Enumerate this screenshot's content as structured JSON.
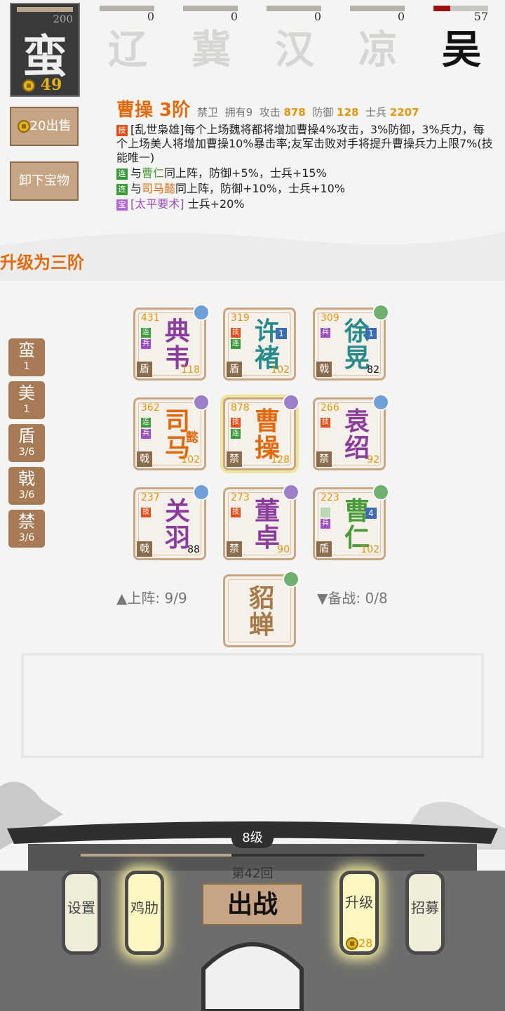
{
  "factions": [
    {
      "glyph": "蛮",
      "count": "200",
      "gold": "49",
      "active": true
    },
    {
      "glyph": "辽",
      "count": "0"
    },
    {
      "glyph": "冀",
      "count": "0"
    },
    {
      "glyph": "汉",
      "count": "0"
    },
    {
      "glyph": "凉",
      "count": "0"
    },
    {
      "glyph": "吴",
      "count": "57",
      "progress": 0.3,
      "highlight": true
    }
  ],
  "left_buttons": {
    "sell": "20出售",
    "unequip": "卸下宝物"
  },
  "hero": {
    "name": "曹操 3阶",
    "stats": [
      {
        "k": "禁卫",
        "v": ""
      },
      {
        "k": "拥有9",
        "v": ""
      },
      {
        "k": "攻击",
        "v": "878"
      },
      {
        "k": "防御",
        "v": "128"
      },
      {
        "k": "士兵",
        "v": "2207"
      }
    ],
    "skill_tag": "技",
    "skill": "[乱世枭雄]每个上场魏将都将增加曹操4%攻击，3%防御，3%兵力，每个上场美人将增加曹操10%暴击率;友军击败对手将提升曹操兵力上限7%(技能唯一)",
    "link_tag": "连",
    "link1_pre": "与",
    "link1_name": "曹仁",
    "link1_post": "同上阵，防御+5%，士兵+15%",
    "link2_pre": "与",
    "link2_name": "司马懿",
    "link2_post": "同上阵，防御+10%，士兵+10%",
    "treasure_tag": "宝",
    "treasure_name": "[太平要术]",
    "treasure_post": " 士兵+20%"
  },
  "upgrade_text": "升级为三阶",
  "filters": [
    {
      "t": "蛮",
      "n": "1"
    },
    {
      "t": "美",
      "n": "1"
    },
    {
      "t": "盾",
      "n": "3/6"
    },
    {
      "t": "戟",
      "n": "3/6"
    },
    {
      "t": "禁",
      "n": "3/6"
    }
  ],
  "cards": [
    {
      "lvl": "431",
      "name1": "典",
      "name2": "韦",
      "cls": "盾",
      "pw": "118",
      "color": "#8a3d9a",
      "tags": [
        "连",
        "兵"
      ],
      "eq": "#6f9fd9"
    },
    {
      "lvl": "319",
      "name1": "许",
      "name2": "褚",
      "cls": "盾",
      "pw": "102",
      "color": "#2a8a8a",
      "tags": [
        "技",
        "连"
      ],
      "eq": "",
      "star": "1"
    },
    {
      "lvl": "309",
      "name1": "徐",
      "name2": "晃",
      "cls": "戟",
      "pw": "82",
      "color": "#2a8a8a",
      "tags": [
        "兵"
      ],
      "eq": "#6fb06f",
      "star": "1",
      "pwk": true
    },
    {
      "lvl": "362",
      "name1": "司",
      "name2": "马",
      "extra": "懿",
      "cls": "戟",
      "pw": "102",
      "color": "#e06a10",
      "tags": [
        "连",
        "兵"
      ],
      "eq": "#9b7fc9"
    },
    {
      "lvl": "878",
      "name1": "曹",
      "name2": "操",
      "cls": "禁",
      "pw": "128",
      "color": "#e06a10",
      "tags": [
        "技",
        "连2"
      ],
      "eq": "#9b7fc9",
      "sel": true
    },
    {
      "lvl": "266",
      "name1": "袁",
      "name2": "绍",
      "cls": "禁",
      "pw": "92",
      "color": "#8a3d9a",
      "tags": [
        "技"
      ],
      "eq": "#6f9fd9"
    },
    {
      "lvl": "237",
      "name1": "关",
      "name2": "羽",
      "cls": "戟",
      "pw": "88",
      "color": "#8a3d9a",
      "tags": [
        "技"
      ],
      "eq": "#6f9fd9",
      "pwk": true
    },
    {
      "lvl": "273",
      "name1": "董",
      "name2": "卓",
      "cls": "禁",
      "pw": "90",
      "color": "#8a3d9a",
      "tags": [
        "技"
      ],
      "eq": "#9b7fc9"
    },
    {
      "lvl": "223",
      "name1": "曹",
      "name2": "仁",
      "cls": "盾",
      "pw": "102",
      "color": "#4a9a3a",
      "tags": [
        "",
        "兵"
      ],
      "eq": "#6fb06f",
      "star": "4"
    }
  ],
  "bench_card": {
    "name1": "貂",
    "name2": "蝉"
  },
  "onfield": "上阵: 9/9",
  "reserve": "备战: 0/8",
  "level": "8级",
  "round": "第42回",
  "fight": "出战",
  "lanterns": [
    {
      "t": "设置"
    },
    {
      "t": "鸡肋"
    },
    {
      "t": "升级",
      "cost": "28"
    },
    {
      "t": "招募"
    }
  ]
}
